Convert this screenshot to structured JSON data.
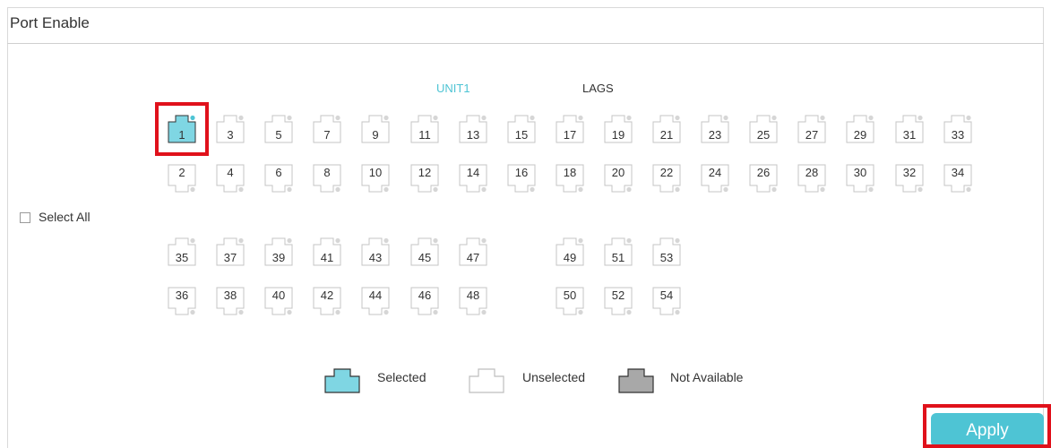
{
  "panel": {
    "title": "Port Enable"
  },
  "tabs": [
    {
      "label": "UNIT1",
      "active": true
    },
    {
      "label": "LAGS",
      "active": false
    }
  ],
  "ports": {
    "row1": [
      "1",
      "3",
      "5",
      "7",
      "9",
      "11",
      "13",
      "15",
      "17",
      "19",
      "21",
      "23",
      "25",
      "27",
      "29",
      "31",
      "33"
    ],
    "row2": [
      "2",
      "4",
      "6",
      "8",
      "10",
      "12",
      "14",
      "16",
      "18",
      "20",
      "22",
      "24",
      "26",
      "28",
      "30",
      "32",
      "34"
    ],
    "row3": [
      "35",
      "37",
      "39",
      "41",
      "43",
      "45",
      "47",
      "49",
      "51",
      "53"
    ],
    "row4": [
      "36",
      "38",
      "40",
      "42",
      "44",
      "46",
      "48",
      "50",
      "52",
      "54"
    ],
    "selected": [
      "1"
    ]
  },
  "select_all": {
    "label": "Select All",
    "checked": false
  },
  "legend": {
    "selected": "Selected",
    "unselected": "Unselected",
    "not_available": "Not Available"
  },
  "apply_button": {
    "label": "Apply"
  },
  "colors": {
    "accent": "#4ec4d4",
    "selected_fill": "#7fd6e3",
    "not_available_fill": "#a8a8a8",
    "highlight": "#e0111b"
  }
}
